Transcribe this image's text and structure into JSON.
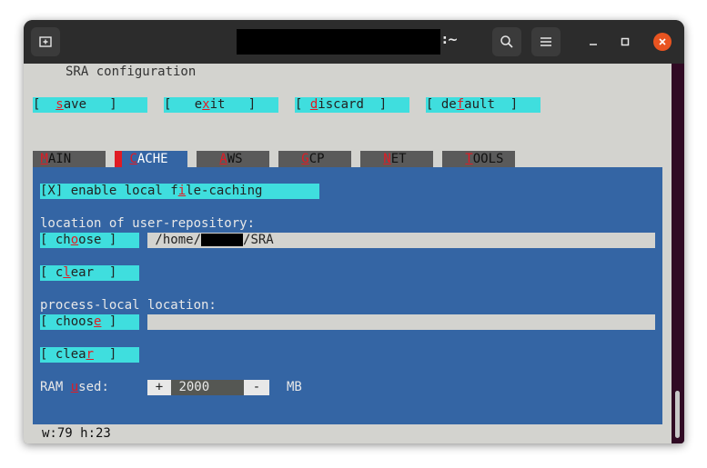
{
  "window": {
    "title_suffix": ":~"
  },
  "app": {
    "header": "SRA configuration",
    "status": "w:79 h:23"
  },
  "actions": {
    "save": {
      "pre": "[  ",
      "hot": "s",
      "post": "ave   ]"
    },
    "exit": {
      "pre": "[   e",
      "hot": "x",
      "post": "it   ]"
    },
    "discard": {
      "pre": "[ ",
      "hot": "d",
      "post": "iscard  ]"
    },
    "default": {
      "pre": "[ de",
      "hot": "f",
      "post": "ault  ]"
    }
  },
  "tabs": [
    {
      "pre": "",
      "hot": "M",
      "post": "AIN"
    },
    {
      "pre": "",
      "hot": "C",
      "post": "ACHE"
    },
    {
      "pre": "",
      "hot": "A",
      "post": "WS"
    },
    {
      "pre": "",
      "hot": "G",
      "post": "CP"
    },
    {
      "pre": "",
      "hot": "N",
      "post": "ET"
    },
    {
      "pre": "",
      "hot": "T",
      "post": "OOLS"
    }
  ],
  "cache": {
    "enable": {
      "pre": "[X] enable local f",
      "hot": "i",
      "post": "le-caching"
    },
    "user_repo_label": "location of user-repository:",
    "choose1": {
      "pre": "[ ch",
      "hot": "o",
      "post": "ose ]"
    },
    "user_repo_path_pre": " /home/",
    "user_repo_path_post": "/SRA",
    "clear1": {
      "pre": "[ c",
      "hot": "l",
      "post": "ear  ]"
    },
    "process_label": "process-local location:",
    "choose2": {
      "pre": "[ choos",
      "hot": "e",
      "post": " ]"
    },
    "process_path": "",
    "clear2": {
      "pre": "[ clea",
      "hot": "r",
      "post": "  ]"
    },
    "ram_pre": "RAM ",
    "ram_hot": "u",
    "ram_post": "sed:",
    "ram_plus": "+",
    "ram_value": "2000",
    "ram_minus": "-",
    "ram_unit": "MB"
  },
  "colors": {
    "accent_cyan": "#3fdede",
    "panel_blue": "#3465a4",
    "hotkey_red": "#e01b24",
    "close_orange": "#e95420"
  }
}
